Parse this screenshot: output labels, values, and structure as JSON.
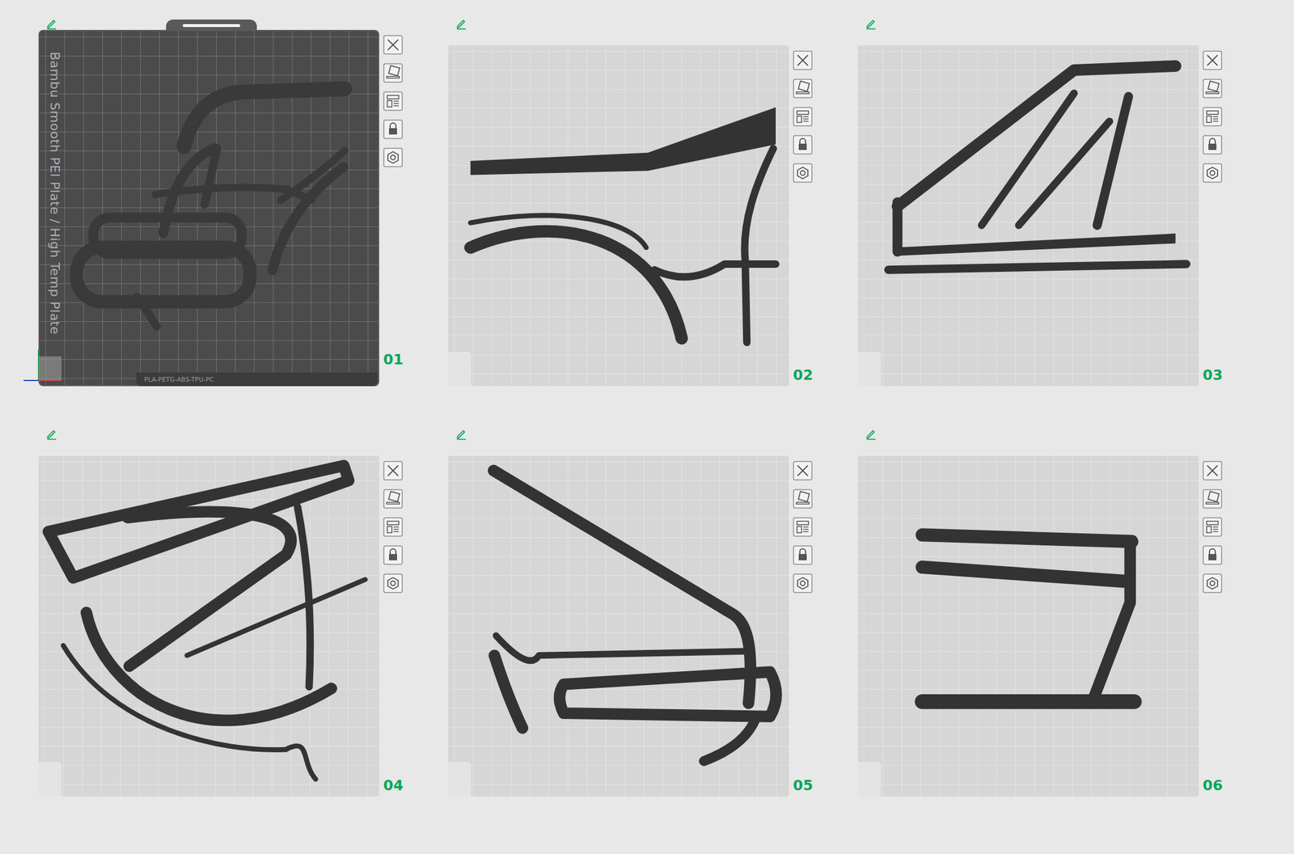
{
  "bed": {
    "label": "Bambu Smooth PEI Plate / High Temp Plate",
    "filament_types": "PLA-PETG-ABS-TPU-PC"
  },
  "plates": [
    {
      "number": "01",
      "selected": true
    },
    {
      "number": "02",
      "selected": false
    },
    {
      "number": "03",
      "selected": false
    },
    {
      "number": "04",
      "selected": false
    },
    {
      "number": "05",
      "selected": false
    },
    {
      "number": "06",
      "selected": false
    }
  ]
}
